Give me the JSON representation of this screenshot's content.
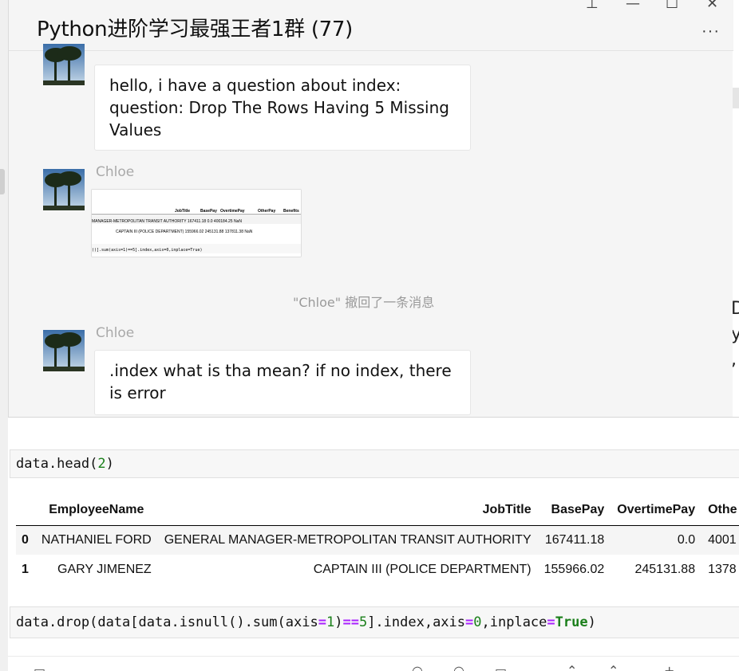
{
  "chat": {
    "title": "Python进阶学习最强王者1群 (77)",
    "window_controls": {
      "pin": "⊥",
      "minimize": "—",
      "maximize": "☐",
      "close": "✕"
    },
    "more": "···",
    "messages": [
      {
        "text": "hello, i have a question about index: question: Drop The Rows Having 5 Missing Values"
      },
      {
        "sender": "Chloe",
        "type": "image",
        "thumb": {
          "headers": [
            "JobTitle",
            "BasePay",
            "OvertimePay",
            "OtherPay",
            "Benefits"
          ],
          "row1": "MANAGER-METROPOLITAN TRANSIT AUTHORITY   167411.18        0.0   400184.25    NaN",
          "row2": "CAPTAIN III (POLICE DEPARTMENT)   155966.02   245131.88   137811.38    NaN",
          "code": "()].sum(axis=1)==5].index,axis=0,inplace=True)"
        }
      },
      {
        "type": "system",
        "text": "\"Chloe\" 撤回了一条消息"
      },
      {
        "sender": "Chloe",
        "text": ".index  what is tha mean? if no index, there is error"
      }
    ]
  },
  "background_text": [
    "D",
    "y",
    ","
  ],
  "notebook": {
    "cell1": {
      "code": "data.head(",
      "arg": "2",
      "close": ")"
    },
    "dataframe": {
      "columns": [
        "",
        "EmployeeName",
        "JobTitle",
        "BasePay",
        "OvertimePay",
        "Othe"
      ],
      "rows": [
        [
          "0",
          "NATHANIEL FORD",
          "GENERAL MANAGER-METROPOLITAN TRANSIT AUTHORITY",
          "167411.18",
          "0.0",
          "4001"
        ],
        [
          "1",
          "GARY JIMENEZ",
          "CAPTAIN III (POLICE DEPARTMENT)",
          "155966.02",
          "245131.88",
          "1378"
        ]
      ]
    },
    "cell2": {
      "p1": "data.drop(data[data.isnull().sum(axis",
      "eq1": "=",
      "one": "1",
      "p2": ")",
      "eqeq": "==",
      "five": "5",
      "p3": "].index,axis",
      "eq2": "=",
      "zero": "0",
      "p4": ",inplace",
      "eq3": "=",
      "true": "True",
      "p5": ")"
    }
  },
  "colors": {
    "chat_bg": "#f5f5f5",
    "bubble": "#ffffff",
    "sender": "#a9a9a9",
    "code_number": "#1a7f1a",
    "code_operator": "#aa22ff"
  }
}
